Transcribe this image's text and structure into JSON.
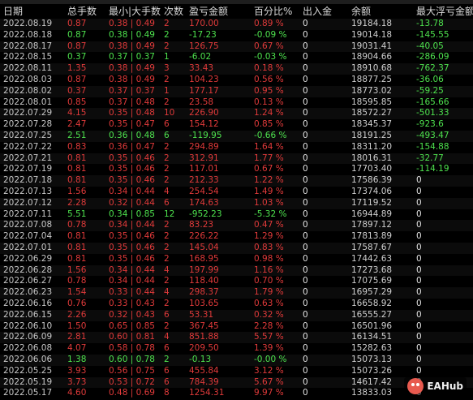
{
  "headers": {
    "date": "日期",
    "total_lots": "总手数",
    "min_max_lots": "最小|大手数",
    "count": "次数",
    "pnl": "盈亏金额",
    "pct": "百分比%",
    "deposit": "出入金",
    "balance": "余额",
    "max_float_loss": "最大浮亏金额"
  },
  "rows": [
    {
      "date": "2022.08.19",
      "total": "0.87",
      "minmax": "0.38 | 0.49",
      "count": "2",
      "pnl": "170.00",
      "pct": "0.89 %",
      "dep": "0",
      "bal": "19184.18",
      "float": "-13.78",
      "sign": "red"
    },
    {
      "date": "2022.08.18",
      "total": "0.87",
      "minmax": "0.38 | 0.49",
      "count": "2",
      "pnl": "-17.23",
      "pct": "-0.09 %",
      "dep": "0",
      "bal": "19014.18",
      "float": "-145.55",
      "sign": "green"
    },
    {
      "date": "2022.08.17",
      "total": "0.87",
      "minmax": "0.38 | 0.49",
      "count": "2",
      "pnl": "126.75",
      "pct": "0.67 %",
      "dep": "0",
      "bal": "19031.41",
      "float": "-40.05",
      "sign": "red"
    },
    {
      "date": "2022.08.15",
      "total": "0.37",
      "minmax": "0.37 | 0.37",
      "count": "1",
      "pnl": "-6.02",
      "pct": "-0.03 %",
      "dep": "0",
      "bal": "18904.66",
      "float": "-286.09",
      "sign": "green"
    },
    {
      "date": "2022.08.11",
      "total": "1.35",
      "minmax": "0.38 | 0.49",
      "count": "3",
      "pnl": "33.43",
      "pct": "0.18 %",
      "dep": "0",
      "bal": "18910.68",
      "float": "-762.37",
      "sign": "red"
    },
    {
      "date": "2022.08.03",
      "total": "0.87",
      "minmax": "0.38 | 0.49",
      "count": "2",
      "pnl": "104.23",
      "pct": "0.56 %",
      "dep": "0",
      "bal": "18877.25",
      "float": "-36.06",
      "sign": "red"
    },
    {
      "date": "2022.08.02",
      "total": "0.37",
      "minmax": "0.37 | 0.37",
      "count": "1",
      "pnl": "177.17",
      "pct": "0.95 %",
      "dep": "0",
      "bal": "18773.02",
      "float": "-59.25",
      "sign": "red"
    },
    {
      "date": "2022.08.01",
      "total": "0.85",
      "minmax": "0.37 | 0.48",
      "count": "2",
      "pnl": "23.58",
      "pct": "0.13 %",
      "dep": "0",
      "bal": "18595.85",
      "float": "-165.66",
      "sign": "red"
    },
    {
      "date": "2022.07.29",
      "total": "4.15",
      "minmax": "0.35 | 0.48",
      "count": "10",
      "pnl": "226.90",
      "pct": "1.24 %",
      "dep": "0",
      "bal": "18572.27",
      "float": "-501.33",
      "sign": "red"
    },
    {
      "date": "2022.07.28",
      "total": "2.47",
      "minmax": "0.35 | 0.47",
      "count": "6",
      "pnl": "154.12",
      "pct": "0.85 %",
      "dep": "0",
      "bal": "18345.37",
      "float": "-923.6",
      "sign": "red"
    },
    {
      "date": "2022.07.25",
      "total": "2.51",
      "minmax": "0.36 | 0.48",
      "count": "6",
      "pnl": "-119.95",
      "pct": "-0.66 %",
      "dep": "0",
      "bal": "18191.25",
      "float": "-493.47",
      "sign": "green"
    },
    {
      "date": "2022.07.22",
      "total": "0.83",
      "minmax": "0.36 | 0.47",
      "count": "2",
      "pnl": "294.89",
      "pct": "1.64 %",
      "dep": "0",
      "bal": "18311.20",
      "float": "-154.88",
      "sign": "red"
    },
    {
      "date": "2022.07.21",
      "total": "0.81",
      "minmax": "0.35 | 0.46",
      "count": "2",
      "pnl": "312.91",
      "pct": "1.77 %",
      "dep": "0",
      "bal": "18016.31",
      "float": "-32.77",
      "sign": "red"
    },
    {
      "date": "2022.07.19",
      "total": "0.81",
      "minmax": "0.35 | 0.46",
      "count": "2",
      "pnl": "117.01",
      "pct": "0.67 %",
      "dep": "0",
      "bal": "17703.40",
      "float": "-114.19",
      "sign": "red"
    },
    {
      "date": "2022.07.18",
      "total": "0.81",
      "minmax": "0.35 | 0.46",
      "count": "2",
      "pnl": "212.33",
      "pct": "1.22 %",
      "dep": "0",
      "bal": "17586.39",
      "float": "0",
      "sign": "red"
    },
    {
      "date": "2022.07.13",
      "total": "1.56",
      "minmax": "0.34 | 0.44",
      "count": "4",
      "pnl": "254.54",
      "pct": "1.49 %",
      "dep": "0",
      "bal": "17374.06",
      "float": "0",
      "sign": "red"
    },
    {
      "date": "2022.07.12",
      "total": "2.28",
      "minmax": "0.32 | 0.44",
      "count": "6",
      "pnl": "174.63",
      "pct": "1.03 %",
      "dep": "0",
      "bal": "17119.52",
      "float": "0",
      "sign": "red"
    },
    {
      "date": "2022.07.11",
      "total": "5.51",
      "minmax": "0.34 | 0.85",
      "count": "12",
      "pnl": "-952.23",
      "pct": "-5.32 %",
      "dep": "0",
      "bal": "16944.89",
      "float": "0",
      "sign": "green"
    },
    {
      "date": "2022.07.08",
      "total": "0.78",
      "minmax": "0.34 | 0.44",
      "count": "2",
      "pnl": "83.23",
      "pct": "0.47 %",
      "dep": "0",
      "bal": "17897.12",
      "float": "0",
      "sign": "red"
    },
    {
      "date": "2022.07.04",
      "total": "0.81",
      "minmax": "0.35 | 0.46",
      "count": "2",
      "pnl": "226.22",
      "pct": "1.29 %",
      "dep": "0",
      "bal": "17813.89",
      "float": "0",
      "sign": "red"
    },
    {
      "date": "2022.07.01",
      "total": "0.81",
      "minmax": "0.35 | 0.46",
      "count": "2",
      "pnl": "145.04",
      "pct": "0.83 %",
      "dep": "0",
      "bal": "17587.67",
      "float": "0",
      "sign": "red"
    },
    {
      "date": "2022.06.29",
      "total": "0.81",
      "minmax": "0.35 | 0.46",
      "count": "2",
      "pnl": "168.95",
      "pct": "0.98 %",
      "dep": "0",
      "bal": "17442.63",
      "float": "0",
      "sign": "red"
    },
    {
      "date": "2022.06.28",
      "total": "1.56",
      "minmax": "0.34 | 0.44",
      "count": "4",
      "pnl": "197.99",
      "pct": "1.16 %",
      "dep": "0",
      "bal": "17273.68",
      "float": "0",
      "sign": "red"
    },
    {
      "date": "2022.06.27",
      "total": "0.78",
      "minmax": "0.34 | 0.44",
      "count": "2",
      "pnl": "118.40",
      "pct": "0.70 %",
      "dep": "0",
      "bal": "17075.69",
      "float": "0",
      "sign": "red"
    },
    {
      "date": "2022.06.23",
      "total": "1.54",
      "minmax": "0.33 | 0.44",
      "count": "4",
      "pnl": "298.37",
      "pct": "1.79 %",
      "dep": "0",
      "bal": "16957.29",
      "float": "0",
      "sign": "red"
    },
    {
      "date": "2022.06.16",
      "total": "0.76",
      "minmax": "0.33 | 0.43",
      "count": "2",
      "pnl": "103.65",
      "pct": "0.63 %",
      "dep": "0",
      "bal": "16658.92",
      "float": "0",
      "sign": "red"
    },
    {
      "date": "2022.06.15",
      "total": "2.26",
      "minmax": "0.32 | 0.43",
      "count": "6",
      "pnl": "53.31",
      "pct": "0.32 %",
      "dep": "0",
      "bal": "16555.27",
      "float": "0",
      "sign": "red"
    },
    {
      "date": "2022.06.10",
      "total": "1.50",
      "minmax": "0.65 | 0.85",
      "count": "2",
      "pnl": "367.45",
      "pct": "2.28 %",
      "dep": "0",
      "bal": "16501.96",
      "float": "0",
      "sign": "red"
    },
    {
      "date": "2022.06.09",
      "total": "2.81",
      "minmax": "0.60 | 0.81",
      "count": "4",
      "pnl": "851.88",
      "pct": "5.57 %",
      "dep": "0",
      "bal": "16134.51",
      "float": "0",
      "sign": "red"
    },
    {
      "date": "2022.06.08",
      "total": "4.07",
      "minmax": "0.58 | 0.78",
      "count": "6",
      "pnl": "209.50",
      "pct": "1.39 %",
      "dep": "0",
      "bal": "15282.63",
      "float": "0",
      "sign": "red"
    },
    {
      "date": "2022.06.06",
      "total": "1.38",
      "minmax": "0.60 | 0.78",
      "count": "2",
      "pnl": "-0.13",
      "pct": "-0.00 %",
      "dep": "0",
      "bal": "15073.13",
      "float": "0",
      "sign": "green"
    },
    {
      "date": "2022.05.25",
      "total": "3.93",
      "minmax": "0.56 | 0.75",
      "count": "6",
      "pnl": "455.84",
      "pct": "3.12 %",
      "dep": "0",
      "bal": "15073.26",
      "float": "0",
      "sign": "red"
    },
    {
      "date": "2022.05.19",
      "total": "3.73",
      "minmax": "0.53 | 0.72",
      "count": "6",
      "pnl": "784.39",
      "pct": "5.67 %",
      "dep": "0",
      "bal": "14617.42",
      "float": "0",
      "sign": "red"
    },
    {
      "date": "2022.05.17",
      "total": "4.60",
      "minmax": "0.48 | 0.69",
      "count": "8",
      "pnl": "1254.31",
      "pct": "9.97 %",
      "dep": "0",
      "bal": "13833.03",
      "float": "0",
      "sign": "red"
    }
  ],
  "watermark": {
    "text": "EAHub",
    "icon": "pig-logo-icon"
  },
  "colors": {
    "positive": "#e03a3a",
    "negative": "#4ee24e",
    "background": "#000000"
  }
}
